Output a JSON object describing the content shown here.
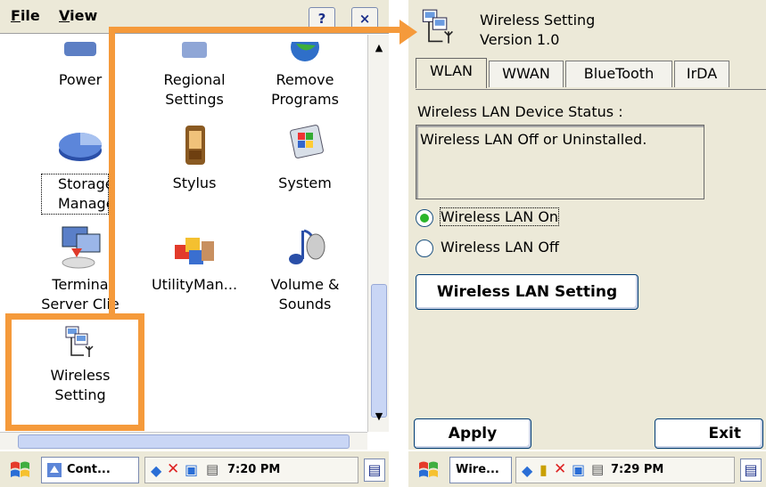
{
  "left_screen": {
    "menu": {
      "file": "File",
      "view": "View"
    },
    "toolbar": {
      "help": "?",
      "close": "×"
    },
    "items": [
      {
        "label_lines": [
          "Power"
        ]
      },
      {
        "label_lines": [
          "Regional",
          "Settings"
        ]
      },
      {
        "label_lines": [
          "Remove",
          "Programs"
        ]
      },
      {
        "label_lines": [
          "Storage",
          "Manage"
        ]
      },
      {
        "label_lines": [
          "Stylus"
        ]
      },
      {
        "label_lines": [
          "System"
        ]
      },
      {
        "label_lines": [
          "Termina",
          "Server Clie"
        ]
      },
      {
        "label_lines": [
          "UtilityMan..."
        ]
      },
      {
        "label_lines": [
          "Volume &",
          "Sounds"
        ]
      },
      {
        "label_lines": [
          "Wireless",
          "Setting"
        ]
      }
    ],
    "taskbar": {
      "task": "Cont...",
      "clock": "7:20 PM"
    }
  },
  "right_screen": {
    "app": {
      "title": "Wireless Setting",
      "version": "Version 1.0"
    },
    "tabs": [
      "WLAN",
      "WWAN",
      "BlueTooth",
      "IrDA"
    ],
    "active_tab": "WLAN",
    "status_label": "Wireless LAN Device Status :",
    "status_value": "Wireless LAN Off or Uninstalled.",
    "radio_on": "Wireless LAN On",
    "radio_off": "Wireless LAN Off",
    "selected_radio": "Wireless LAN On",
    "setting_button": "Wireless LAN Setting",
    "apply_button": "Apply",
    "exit_button": "Exit",
    "taskbar": {
      "task": "Wire...",
      "clock": "7:29 PM"
    }
  },
  "colors": {
    "annotation": "#f59a3b",
    "dialog_bg": "#ece9d8",
    "radio_check": "#2bb52b"
  }
}
